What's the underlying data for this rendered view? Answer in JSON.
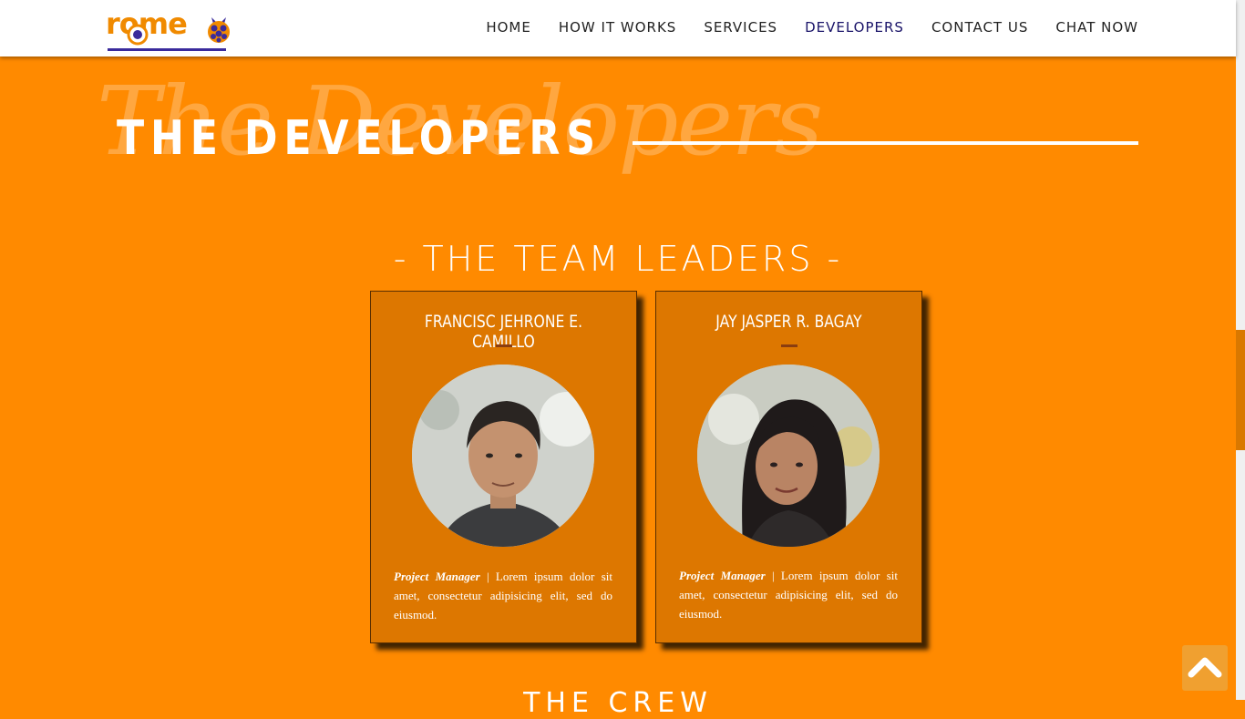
{
  "nav": {
    "logo_text": "rome",
    "items": [
      {
        "label": "HOME"
      },
      {
        "label": "HOW IT WORKS"
      },
      {
        "label": "SERVICES"
      },
      {
        "label": "DEVELOPERS"
      },
      {
        "label": "CONTACT US"
      },
      {
        "label": "CHAT NOW"
      }
    ],
    "active": "DEVELOPERS"
  },
  "hero": {
    "script_text": "The Developers",
    "title": "THE DEVELOPERS"
  },
  "team_leaders": {
    "title": "- THE TEAM LEADERS -",
    "cards": [
      {
        "name": "FRANCISC JEHRONE E. CAMILLO",
        "role": "Project Manager",
        "separator": " | ",
        "description": "Lorem ipsum dolor sit amet, consectetur adipisicing elit, sed do eiusmod."
      },
      {
        "name": "JAY JASPER R. BAGAY",
        "role": "Project Manager",
        "separator": " | ",
        "description": "Lorem ipsum dolor sit amet, consectetur adipisicing elit, sed do eiusmod."
      }
    ]
  },
  "crew": {
    "title": "THE CREW"
  },
  "icons": {
    "logo": "raspberry-pi-logo-icon",
    "back_to_top": "chevron-up-icon"
  },
  "colors": {
    "background": "#ff8a00",
    "card": "#dd7700",
    "nav_active": "#1a1469",
    "logo": "#f08a00"
  }
}
